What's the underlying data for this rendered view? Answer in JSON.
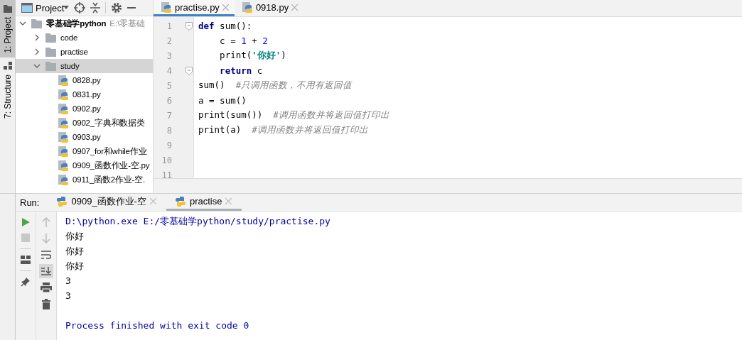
{
  "tool_strip": [
    {
      "label": "1: Project",
      "selected": true
    },
    {
      "label": "7: Structure",
      "selected": false
    }
  ],
  "project_panel": {
    "title": "Project",
    "tree": [
      {
        "label": "零基础学python",
        "path": "E:\\零基础",
        "kind": "folder",
        "expanded": true,
        "selected": false,
        "children": [
          {
            "label": "code",
            "kind": "folder",
            "expanded": false,
            "selected": false
          },
          {
            "label": "practise",
            "kind": "folder",
            "expanded": false,
            "selected": false
          },
          {
            "label": "study",
            "kind": "folder",
            "expanded": true,
            "selected": true,
            "children": [
              {
                "label": "0828.py",
                "kind": "file",
                "selected": false
              },
              {
                "label": "0831.py",
                "kind": "file",
                "selected": false
              },
              {
                "label": "0902.py",
                "kind": "file",
                "selected": false
              },
              {
                "label": "0902_字典和数据类",
                "kind": "file",
                "selected": false
              },
              {
                "label": "0903.py",
                "kind": "file",
                "selected": false
              },
              {
                "label": "0907_for和while作业",
                "kind": "file",
                "selected": false
              },
              {
                "label": "0909_函数作业-空.py",
                "kind": "file",
                "selected": false
              },
              {
                "label": "0911_函数2作业-空.",
                "kind": "file",
                "selected": false
              }
            ]
          }
        ]
      }
    ]
  },
  "editor": {
    "tabs": [
      {
        "label": "practise.py",
        "selected": true
      },
      {
        "label": "0918.py",
        "selected": false
      }
    ],
    "lines": [
      {
        "number": "1",
        "fold": true,
        "tokens": [
          {
            "text": "def",
            "kind": "kw"
          },
          {
            "text": " sum():",
            "kind": "plain"
          }
        ]
      },
      {
        "number": "2",
        "fold": false,
        "tokens": [
          {
            "text": "    c = ",
            "kind": "plain"
          },
          {
            "text": "1",
            "kind": "num"
          },
          {
            "text": " + ",
            "kind": "plain"
          },
          {
            "text": "2",
            "kind": "num"
          }
        ]
      },
      {
        "number": "3",
        "fold": false,
        "tokens": [
          {
            "text": "    print(",
            "kind": "plain"
          },
          {
            "text": "'你好'",
            "kind": "str"
          },
          {
            "text": ")",
            "kind": "plain"
          }
        ]
      },
      {
        "number": "4",
        "fold": true,
        "tokens": [
          {
            "text": "    return",
            "kind": "kw"
          },
          {
            "text": " c",
            "kind": "plain"
          }
        ]
      },
      {
        "number": "5",
        "fold": false,
        "tokens": [
          {
            "text": "sum()  ",
            "kind": "plain"
          },
          {
            "text": "#只调用函数，不用有返回值",
            "kind": "cmt"
          }
        ]
      },
      {
        "number": "6",
        "fold": false,
        "tokens": [
          {
            "text": "a = sum()",
            "kind": "plain"
          }
        ]
      },
      {
        "number": "7",
        "fold": false,
        "tokens": [
          {
            "text": "print(sum())  ",
            "kind": "plain"
          },
          {
            "text": "#调用函数并将返回值打印出",
            "kind": "cmt"
          }
        ]
      },
      {
        "number": "8",
        "fold": false,
        "tokens": [
          {
            "text": "print(a)  ",
            "kind": "plain"
          },
          {
            "text": "#调用函数并将返回值打印出",
            "kind": "cmt"
          }
        ]
      },
      {
        "number": "9",
        "fold": false
      },
      {
        "number": "10",
        "fold": false
      },
      {
        "number": "11",
        "fold": false
      }
    ]
  },
  "run_panel": {
    "label": "Run:",
    "tabs": [
      {
        "label": "0909_函数作业-空",
        "selected": false
      },
      {
        "label": "practise",
        "selected": true
      }
    ],
    "output": [
      {
        "text": "D:\\python.exe E:/零基础学python/study/practise.py",
        "kind": "command"
      },
      {
        "text": "你好",
        "kind": "output"
      },
      {
        "text": "你好",
        "kind": "output"
      },
      {
        "text": "你好",
        "kind": "output"
      },
      {
        "text": "3",
        "kind": "output"
      },
      {
        "text": "3",
        "kind": "output"
      },
      {
        "kind": "blank"
      },
      {
        "text": "Process finished with exit code 0",
        "kind": "command"
      }
    ]
  }
}
